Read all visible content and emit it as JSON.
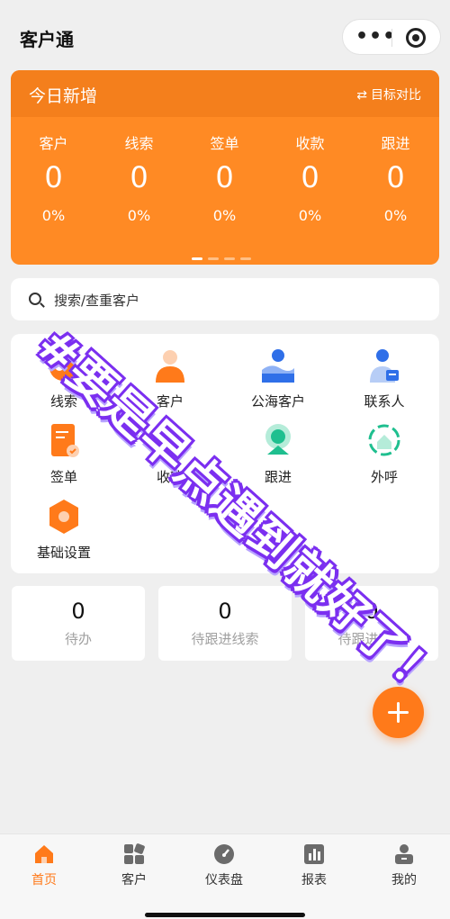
{
  "header": {
    "title": "客户通"
  },
  "today": {
    "title": "今日新增",
    "switch_label": "目标对比",
    "stats": [
      {
        "label": "客户",
        "value": "0",
        "percent": "0%"
      },
      {
        "label": "线索",
        "value": "0",
        "percent": "0%"
      },
      {
        "label": "签单",
        "value": "0",
        "percent": "0%"
      },
      {
        "label": "收款",
        "value": "0",
        "percent": "0%"
      },
      {
        "label": "跟进",
        "value": "0",
        "percent": "0%"
      }
    ]
  },
  "search": {
    "placeholder": "搜索/查重客户"
  },
  "grid": [
    {
      "label": "线索",
      "icon": "lead-icon"
    },
    {
      "label": "客户",
      "icon": "customer-icon"
    },
    {
      "label": "公海客户",
      "icon": "public-customer-icon"
    },
    {
      "label": "联系人",
      "icon": "contact-icon"
    },
    {
      "label": "签单",
      "icon": "contract-icon"
    },
    {
      "label": "收款",
      "icon": "payment-icon"
    },
    {
      "label": "跟进",
      "icon": "followup-icon"
    },
    {
      "label": "外呼",
      "icon": "outbound-call-icon"
    },
    {
      "label": "基础设置",
      "icon": "settings-icon"
    }
  ],
  "todos": [
    {
      "value": "0",
      "label": "待办"
    },
    {
      "value": "0",
      "label": "待跟进线索"
    },
    {
      "value": "0",
      "label": "待跟进客户"
    }
  ],
  "watermark": "#要是早点遇到就好了！",
  "tabs": [
    {
      "label": "首页",
      "icon": "home-icon"
    },
    {
      "label": "客户",
      "icon": "customer-grid-icon"
    },
    {
      "label": "仪表盘",
      "icon": "dashboard-icon"
    },
    {
      "label": "报表",
      "icon": "report-icon"
    },
    {
      "label": "我的",
      "icon": "profile-icon"
    }
  ],
  "colors": {
    "accent": "#ff7a1a",
    "card_orange": "#ff8a24",
    "watermark_stroke": "#7b2ff0"
  }
}
